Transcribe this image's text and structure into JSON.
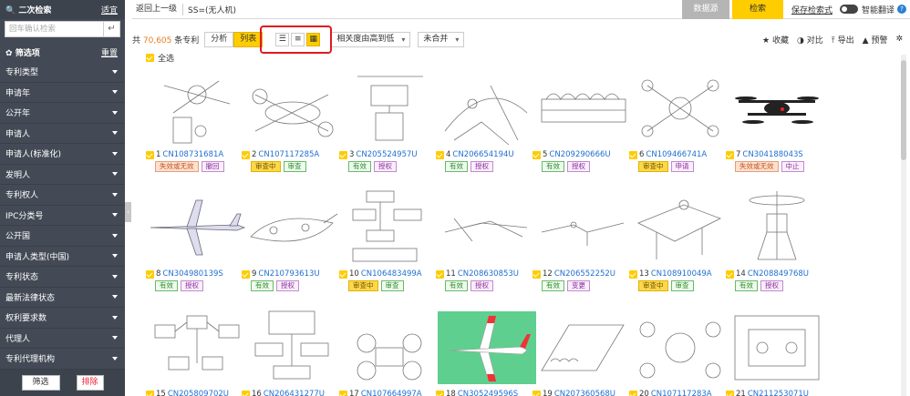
{
  "sidebar": {
    "secondary_search_title": "二次检索",
    "apply_label": "适宜",
    "search_placeholder": "回车确认检索",
    "filter_title": "筛选项",
    "reset_label": "重置",
    "items": [
      {
        "label": "专利类型"
      },
      {
        "label": "申请年"
      },
      {
        "label": "公开年"
      },
      {
        "label": "申请人"
      },
      {
        "label": "申请人(标准化)"
      },
      {
        "label": "发明人"
      },
      {
        "label": "专利权人"
      },
      {
        "label": "IPC分类号"
      },
      {
        "label": "公开国"
      },
      {
        "label": "申请人类型(中国)"
      },
      {
        "label": "专利状态"
      },
      {
        "label": "最新法律状态"
      },
      {
        "label": "权利要求数"
      },
      {
        "label": "代理人"
      },
      {
        "label": "专利代理机构"
      }
    ],
    "filter_button": "筛选",
    "exclude_button": "排除"
  },
  "topbar": {
    "back_label": "返回上一级",
    "query": "SS=(无人机)",
    "source_button": "数据源",
    "search_button": "检索",
    "save_search": "保存检索式",
    "ai_translate": "智能翻译"
  },
  "toolbar": {
    "total_prefix": "共",
    "total_count": "70,605",
    "total_suffix": "条专利",
    "analyze": "分析",
    "list": "列表",
    "sort": "相关度由高到低",
    "merge": "未合并",
    "favorite": "收藏",
    "compare": "对比",
    "export": "导出",
    "alert": "预警"
  },
  "grid": {
    "select_all": "全选",
    "patents": [
      {
        "idx": "1",
        "no": "CN108731681A",
        "tags": [
          {
            "t": "失效或无效",
            "c": "orange"
          },
          {
            "t": "撤回",
            "c": "purple"
          }
        ]
      },
      {
        "idx": "2",
        "no": "CN107117285A",
        "tags": [
          {
            "t": "审查中",
            "c": "yellow"
          },
          {
            "t": "审查",
            "c": "green"
          }
        ]
      },
      {
        "idx": "3",
        "no": "CN205524957U",
        "tags": [
          {
            "t": "有效",
            "c": "green"
          },
          {
            "t": "授权",
            "c": "purple"
          }
        ]
      },
      {
        "idx": "4",
        "no": "CN206654194U",
        "tags": [
          {
            "t": "有效",
            "c": "green"
          },
          {
            "t": "授权",
            "c": "purple"
          }
        ]
      },
      {
        "idx": "5",
        "no": "CN209290666U",
        "tags": [
          {
            "t": "有效",
            "c": "green"
          },
          {
            "t": "授权",
            "c": "purple"
          }
        ]
      },
      {
        "idx": "6",
        "no": "CN109466741A",
        "tags": [
          {
            "t": "审查中",
            "c": "yellow"
          },
          {
            "t": "申请",
            "c": "purple"
          }
        ]
      },
      {
        "idx": "7",
        "no": "CN304188043S",
        "tags": [
          {
            "t": "失效或无效",
            "c": "orange"
          },
          {
            "t": "中止",
            "c": "purple"
          }
        ]
      },
      {
        "idx": "8",
        "no": "CN304980139S",
        "tags": [
          {
            "t": "有效",
            "c": "green"
          },
          {
            "t": "授权",
            "c": "purple"
          }
        ]
      },
      {
        "idx": "9",
        "no": "CN210793613U",
        "tags": [
          {
            "t": "有效",
            "c": "green"
          },
          {
            "t": "授权",
            "c": "purple"
          }
        ]
      },
      {
        "idx": "10",
        "no": "CN106483499A",
        "tags": [
          {
            "t": "审查中",
            "c": "yellow"
          },
          {
            "t": "审查",
            "c": "green"
          }
        ]
      },
      {
        "idx": "11",
        "no": "CN208630853U",
        "tags": [
          {
            "t": "有效",
            "c": "green"
          },
          {
            "t": "授权",
            "c": "purple"
          }
        ]
      },
      {
        "idx": "12",
        "no": "CN206552252U",
        "tags": [
          {
            "t": "有效",
            "c": "green"
          },
          {
            "t": "变更",
            "c": "purple"
          }
        ]
      },
      {
        "idx": "13",
        "no": "CN108910049A",
        "tags": [
          {
            "t": "审查中",
            "c": "yellow"
          },
          {
            "t": "审查",
            "c": "green"
          }
        ]
      },
      {
        "idx": "14",
        "no": "CN208849768U",
        "tags": [
          {
            "t": "有效",
            "c": "green"
          },
          {
            "t": "授权",
            "c": "purple"
          }
        ]
      },
      {
        "idx": "15",
        "no": "CN205809702U",
        "tags": []
      },
      {
        "idx": "16",
        "no": "CN206431277U",
        "tags": []
      },
      {
        "idx": "17",
        "no": "CN107664997A",
        "tags": []
      },
      {
        "idx": "18",
        "no": "CN305249596S",
        "tags": []
      },
      {
        "idx": "19",
        "no": "CN207360568U",
        "tags": []
      },
      {
        "idx": "20",
        "no": "CN107117283A",
        "tags": []
      },
      {
        "idx": "21",
        "no": "CN211253071U",
        "tags": []
      }
    ]
  }
}
